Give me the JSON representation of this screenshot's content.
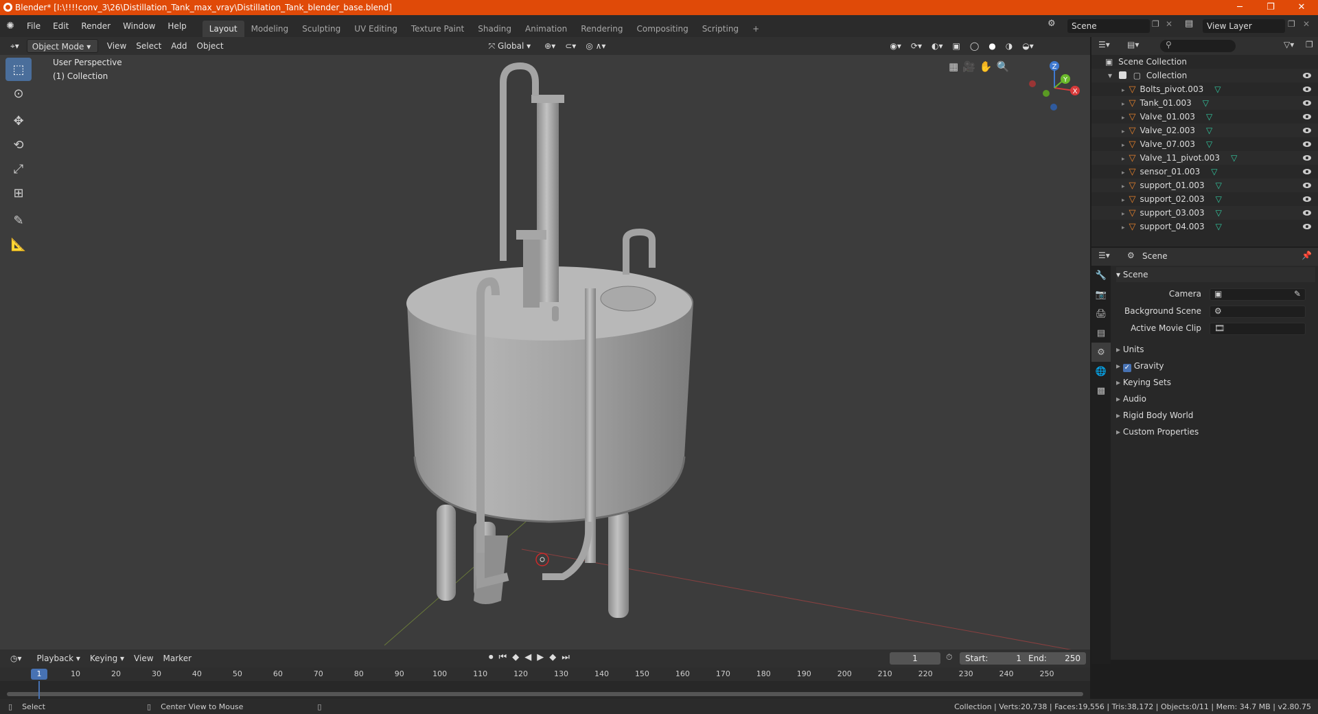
{
  "title_bar": {
    "title": "Blender* [I:\\!!!!conv_3\\26\\Distillation_Tank_max_vray\\Distillation_Tank_blender_base.blend]",
    "minimize": "─",
    "maximize": "❐",
    "close": "✕"
  },
  "menu": {
    "items": [
      "File",
      "Edit",
      "Render",
      "Window",
      "Help"
    ]
  },
  "workspaces": {
    "tabs": [
      "Layout",
      "Modeling",
      "Sculpting",
      "UV Editing",
      "Texture Paint",
      "Shading",
      "Animation",
      "Rendering",
      "Compositing",
      "Scripting"
    ],
    "active": "Layout",
    "add": "+"
  },
  "scene_selector": {
    "value": "Scene"
  },
  "view_layer_selector": {
    "value": "View Layer"
  },
  "viewport_header": {
    "mode": "Object Mode",
    "menus": [
      "View",
      "Select",
      "Add",
      "Object"
    ],
    "transform_orientation": "Global"
  },
  "viewport_overlay": {
    "perspective": "User Perspective",
    "collection": "(1) Collection"
  },
  "gizmo": {
    "x": "X",
    "y": "Y",
    "z": "Z"
  },
  "outliner": {
    "root": "Scene Collection",
    "collection": "Collection",
    "objects": [
      "Bolts_pivot.003",
      "Tank_01.003",
      "Valve_01.003",
      "Valve_02.003",
      "Valve_07.003",
      "Valve_11_pivot.003",
      "sensor_01.003",
      "support_01.003",
      "support_02.003",
      "support_03.003",
      "support_04.003"
    ]
  },
  "properties": {
    "context": "Scene",
    "panel_title": "Scene",
    "camera_label": "Camera",
    "background_scene_label": "Background Scene",
    "active_movie_clip_label": "Active Movie Clip",
    "sections": [
      "Units",
      "Gravity",
      "Keying Sets",
      "Audio",
      "Rigid Body World",
      "Custom Properties"
    ],
    "gravity_checked": true
  },
  "timeline": {
    "menus": [
      "Playback",
      "Keying",
      "View",
      "Marker"
    ],
    "current_frame": "1",
    "start_label": "Start:",
    "start": "1",
    "end_label": "End:",
    "end": "250",
    "ticks": [
      "1",
      "10",
      "20",
      "30",
      "40",
      "50",
      "60",
      "70",
      "80",
      "90",
      "100",
      "110",
      "120",
      "130",
      "140",
      "150",
      "160",
      "170",
      "180",
      "190",
      "200",
      "210",
      "220",
      "230",
      "240",
      "250"
    ]
  },
  "status_bar": {
    "select": "Select",
    "center_view": "Center View to Mouse",
    "stats": "Collection | Verts:20,738 | Faces:19,556 | Tris:38,172 | Objects:0/11 | Mem: 34.7 MB | v2.80.75"
  },
  "colors": {
    "title_bar": "#e04a08",
    "accent": "#4a6e9b",
    "active_frame": "#4772b3",
    "object_icon": "#e8822b",
    "mesh_icon": "#32c8a0"
  }
}
